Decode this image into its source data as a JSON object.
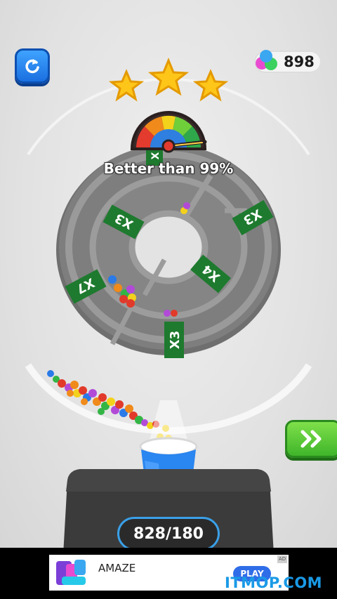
{
  "header": {
    "coins": "898",
    "stars_earned": 3,
    "stars_total": 3
  },
  "result": {
    "better_than": "Better than 99%"
  },
  "board": {
    "multipliers": [
      "X3",
      "X3",
      "X7",
      "X4",
      "X3",
      "X"
    ]
  },
  "score": {
    "value": "828/180"
  },
  "ad": {
    "title": "AMAZE",
    "cta": "PLAY",
    "badge": "AD"
  },
  "watermark": "ITMOP.COM",
  "colors": {
    "primary_blue": "#2a86f0",
    "next_green": "#4cc12f",
    "star_gold": "#ffc61a",
    "score_border": "#3aa0e8"
  }
}
